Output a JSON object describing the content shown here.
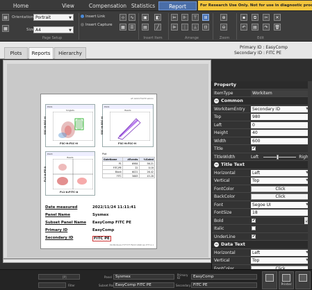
{
  "menu": {
    "tabs": [
      {
        "label": "Home",
        "active": false
      },
      {
        "label": "View",
        "active": false
      },
      {
        "label": "Compensation",
        "active": false
      },
      {
        "label": "Statistics",
        "active": false
      },
      {
        "label": "Report",
        "active": true
      }
    ],
    "notice": "For Research Use Only. Not for use in diagnostic procedures."
  },
  "ribbon": {
    "orientation_label": "Orientation",
    "orientation_value": "Portrait",
    "size_label": "Size",
    "size_value": "A4",
    "insert_link": "Insert Link",
    "insert_capture": "Insert Capture",
    "groups": {
      "page_setup": "Page Setup",
      "insert_item": "Insert Item",
      "arrange": "Arrange",
      "zoom": "Zoom",
      "edit": "Edit"
    }
  },
  "views": {
    "tabs": [
      {
        "label": "Plots",
        "active": false
      },
      {
        "label": "Reports",
        "active": true
      },
      {
        "label": "Hierarchy",
        "active": false
      }
    ],
    "primary_id_label": "Primary ID",
    "primary_id_value": "EasyComp",
    "secondary_id_label": "Secondary ID",
    "secondary_id_value": "FITC PE"
  },
  "report_page": {
    "header_text": "AF-0220 FSCFP admin",
    "plots": [
      {
        "title": "Plot1",
        "subtitle": "Singlets",
        "xlabel": "FSC-H:FSC-H",
        "ylabel": "SSC-H:SSC-H"
      },
      {
        "title": "Plot1",
        "subtitle": "Beads",
        "xlabel": "FSC-H:FSC-H",
        "ylabel": "SSC-H:SSC-H"
      },
      {
        "title": "Plot3",
        "subtitle": "Beads",
        "xlabel": "FL1-A:FITC-A",
        "ylabel": "FL2-A:PE-A"
      }
    ],
    "stats_table": {
      "title": "Plot",
      "columns": [
        "GateName",
        "#Events",
        "%Gated"
      ],
      "rows": [
        [
          "P1",
          "6984",
          "56.21"
        ],
        [
          "FITC/PE",
          "22",
          "0.18"
        ],
        [
          "Blank",
          "6021",
          "26.42"
        ],
        [
          "FITC",
          "5663",
          "45.28"
        ]
      ]
    },
    "info": [
      {
        "key": "Date measured",
        "value": "2022/11/24 11:11:41"
      },
      {
        "key": "Panel Name",
        "value": "Sysmex"
      },
      {
        "key": "Subset Panel Name",
        "value": "EasyComp FITC PE"
      },
      {
        "key": "Primary ID",
        "value": "EasyComp"
      },
      {
        "key": "Secondary ID",
        "value": "FITC PE"
      }
    ],
    "footer_text": "CS-MX-SS-AA-7777777 FSCC7-2020 AA-7777-1.1"
  },
  "properties": {
    "header": "Property",
    "item_type_label": "ItemType",
    "item_type_value": "Workitem",
    "sections": {
      "common": "Common",
      "title_text": "Title Text",
      "data_text": "Data Text"
    },
    "common": [
      {
        "name": "WorkitemEntry",
        "value": "Secondary ID",
        "kind": "dropdown"
      },
      {
        "name": "Top",
        "value": "980",
        "kind": "text"
      },
      {
        "name": "Left",
        "value": "0",
        "kind": "text"
      },
      {
        "name": "Height",
        "value": "40",
        "kind": "text"
      },
      {
        "name": "Width",
        "value": "600",
        "kind": "text"
      },
      {
        "name": "Title",
        "value": "✔",
        "kind": "check"
      },
      {
        "name": "TitleWidth",
        "value": "",
        "kind": "slider"
      }
    ],
    "slider": {
      "left_label": "Left",
      "right_label": "Right",
      "level": 0.45
    },
    "title_text": [
      {
        "name": "Horizontal",
        "value": "Left",
        "kind": "dropdown"
      },
      {
        "name": "Vertical",
        "value": "Top",
        "kind": "dropdown"
      },
      {
        "name": "FontColor",
        "value": "Click",
        "kind": "button"
      },
      {
        "name": "BackColor",
        "value": "Click",
        "kind": "button"
      },
      {
        "name": "Font",
        "value": "Segoe UI",
        "kind": "dropdown"
      },
      {
        "name": "FontSize",
        "value": "18",
        "kind": "text"
      },
      {
        "name": "Bold",
        "value": "✔",
        "kind": "check"
      },
      {
        "name": "Italic",
        "value": "",
        "kind": "check"
      },
      {
        "name": "UnderLine",
        "value": "✔",
        "kind": "check"
      }
    ],
    "data_text": [
      {
        "name": "Horizontal",
        "value": "Left",
        "kind": "dropdown"
      },
      {
        "name": "Vertical",
        "value": "Top",
        "kind": "dropdown"
      },
      {
        "name": "FontColor",
        "value": "Click",
        "kind": "button"
      }
    ]
  },
  "statusbar": {
    "field1": "[P]",
    "panel_label": "Panel",
    "panel_value": "Sysmex",
    "primary_label": "Primary ID",
    "primary_value": "EasyComp",
    "subset_label": "Subset Panel",
    "subset_value": "EasyComp FITC PE",
    "secondary_label": "Secondary",
    "secondary_value": "FITC PE",
    "filter_label": "Filter",
    "printer_label": "Printer"
  },
  "colors": {
    "accent": "#4a6ea8",
    "notice_bg": "#f3c53c"
  }
}
